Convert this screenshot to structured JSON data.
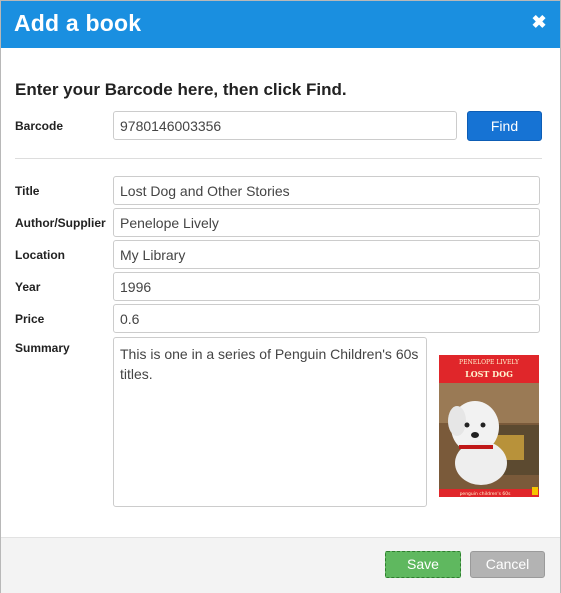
{
  "dialog": {
    "title": "Add a book",
    "close_icon": "close-icon"
  },
  "instruction": "Enter your Barcode here, then click Find.",
  "barcode": {
    "label": "Barcode",
    "value": "9780146003356",
    "find_label": "Find"
  },
  "fields": {
    "title": {
      "label": "Title",
      "value": "Lost Dog and Other Stories"
    },
    "author": {
      "label": "Author/Supplier",
      "value": "Penelope Lively"
    },
    "location": {
      "label": "Location",
      "value": "My Library"
    },
    "year": {
      "label": "Year",
      "value": "1996"
    },
    "price": {
      "label": "Price",
      "value": "0.6"
    },
    "summary": {
      "label": "Summary",
      "value": "This is one in a series of Penguin Children's 60s titles."
    }
  },
  "cover": {
    "author": "PENELOPE LIVELY",
    "title": "LOST DOG",
    "series": "penguin children's 60s"
  },
  "footer": {
    "save_label": "Save",
    "cancel_label": "Cancel"
  },
  "colors": {
    "header": "#1a8fe0",
    "find_button": "#1673d4",
    "save_button": "#5fb85f",
    "cancel_button": "#b3b3b3",
    "cover_red": "#e0262a"
  }
}
